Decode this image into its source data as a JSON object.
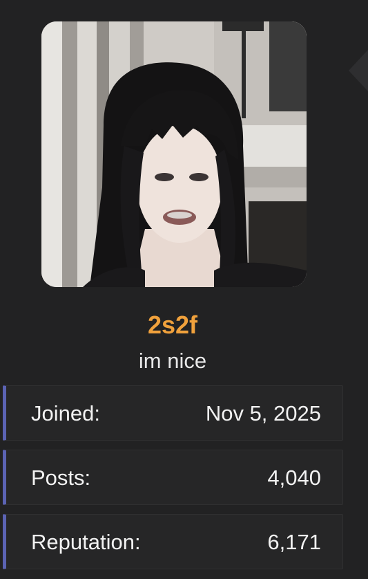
{
  "profile": {
    "username": "2s2f",
    "user_title": "im nice",
    "username_color": "#f0a13c",
    "avatar": "profile-avatar-photo"
  },
  "stats": [
    {
      "label": "Joined:",
      "value": "Nov 5, 2025"
    },
    {
      "label": "Posts:",
      "value": "4,040"
    },
    {
      "label": "Reputation:",
      "value": "6,171"
    }
  ],
  "colors": {
    "background": "#222223",
    "row_background": "#262627",
    "row_accent": "#5b63b3",
    "text": "#f2f2f2"
  }
}
